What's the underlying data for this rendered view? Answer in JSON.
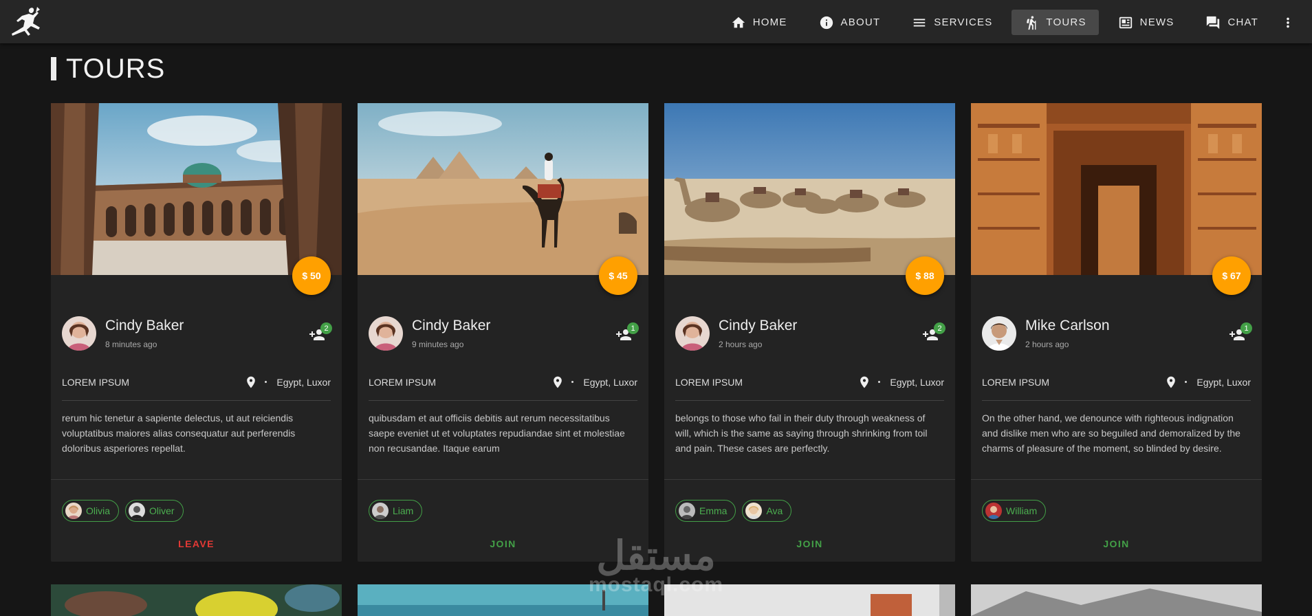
{
  "nav": {
    "items": [
      {
        "label": "HOME",
        "icon": "home-icon"
      },
      {
        "label": "ABOUT",
        "icon": "info-icon"
      },
      {
        "label": "SERVICES",
        "icon": "menu-icon"
      },
      {
        "label": "TOURS",
        "icon": "hiking-icon",
        "active": true
      },
      {
        "label": "NEWS",
        "icon": "news-icon"
      },
      {
        "label": "CHAT",
        "icon": "chat-icon"
      }
    ],
    "more_icon": "more-vert-icon"
  },
  "page": {
    "title": "TOURS"
  },
  "colors": {
    "accent": "#ffa000",
    "join": "#43a047",
    "leave": "#e53935",
    "background": "#161616",
    "card": "#232323"
  },
  "cards": [
    {
      "price": "$ 50",
      "author": "Cindy Baker",
      "time": "8 minutes ago",
      "members_count": "2",
      "category": "LOREM IPSUM",
      "location": "Egypt, Luxor",
      "description": "rerum hic tenetur a sapiente delectus, ut aut reiciendis voluptatibus maiores alias consequatur aut perferendis doloribus asperiores repellat.",
      "members": [
        {
          "name": "Olivia"
        },
        {
          "name": "Oliver"
        }
      ],
      "action": "LEAVE"
    },
    {
      "price": "$ 45",
      "author": "Cindy Baker",
      "time": "9 minutes ago",
      "members_count": "1",
      "category": "LOREM IPSUM",
      "location": "Egypt, Luxor",
      "description": "quibusdam et aut officiis debitis aut rerum necessitatibus saepe eveniet ut et voluptates repudiandae sint et molestiae non recusandae. Itaque earum",
      "members": [
        {
          "name": "Liam"
        }
      ],
      "action": "JOIN"
    },
    {
      "price": "$ 88",
      "author": "Cindy Baker",
      "time": "2 hours ago",
      "members_count": "2",
      "category": "LOREM IPSUM",
      "location": "Egypt, Luxor",
      "description": "belongs to those who fail in their duty through weakness of will, which is the same as saying through shrinking from toil and pain. These cases are perfectly.",
      "members": [
        {
          "name": "Emma"
        },
        {
          "name": "Ava"
        }
      ],
      "action": "JOIN"
    },
    {
      "price": "$ 67",
      "author": "Mike Carlson",
      "time": "2 hours ago",
      "members_count": "1",
      "category": "LOREM IPSUM",
      "location": "Egypt, Luxor",
      "description": "On the other hand, we denounce with righteous indignation and dislike men who are so beguiled and demoralized by the charms of pleasure of the moment, so blinded by desire.",
      "members": [
        {
          "name": "William"
        }
      ],
      "action": "JOIN"
    }
  ],
  "watermark": {
    "arabic": "مستقل",
    "latin": "mostaql.com"
  }
}
